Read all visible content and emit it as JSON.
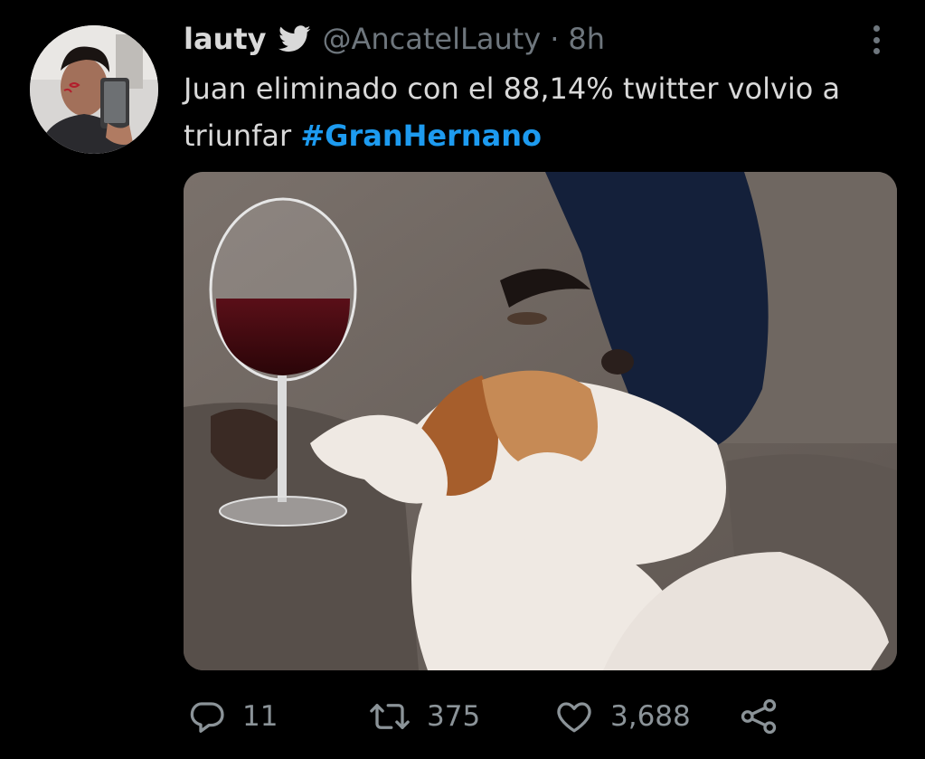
{
  "author": {
    "display_name": "lauty",
    "handle": "@AncatelLauty",
    "separator": "·",
    "time": "8h",
    "verified_icon": "bird-icon"
  },
  "tweet": {
    "text": "Juan eliminado con el 88,14% twitter volvio a triunfar",
    "hashtag": "#GranHernano"
  },
  "stats": {
    "replies": "11",
    "retweets": "375",
    "likes": "3,688"
  },
  "icons": {
    "reply": "reply-icon",
    "retweet": "retweet-icon",
    "like": "heart-icon",
    "share": "share-icon",
    "more": "more-icon"
  },
  "colors": {
    "background": "#000000",
    "text": "#d9d9d9",
    "muted": "#6e767d",
    "accent": "#1d9bf0"
  }
}
